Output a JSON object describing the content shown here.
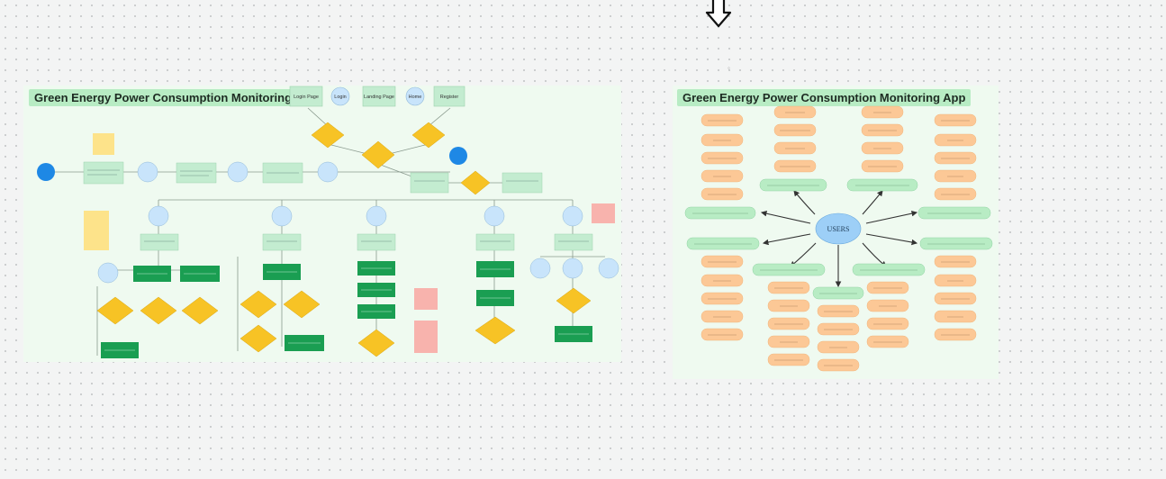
{
  "left_board": {
    "title": "Green Energy Power Consumption Monitoring App",
    "top_labels": [
      "Login Page",
      "Login",
      "Landing Page",
      "Home",
      "Register"
    ]
  },
  "right_board": {
    "title": "Green Energy Power Consumption Monitoring App",
    "center_label": "USERS"
  },
  "colors": {
    "board_bg": "#effaf0",
    "title_bg": "#b8ecc4",
    "node_blue": "#c8e4fb",
    "node_dark_blue": "#1e88e5",
    "node_light_green": "#c3ecd0",
    "node_green": "#1a9e52",
    "node_yellow": "#f7c325",
    "node_orange": "#fcc896",
    "node_pink": "#f8b3ad",
    "node_sticky": "#fde38a"
  },
  "icons": {
    "pan_arrow": "down-arrow-outline-icon"
  }
}
